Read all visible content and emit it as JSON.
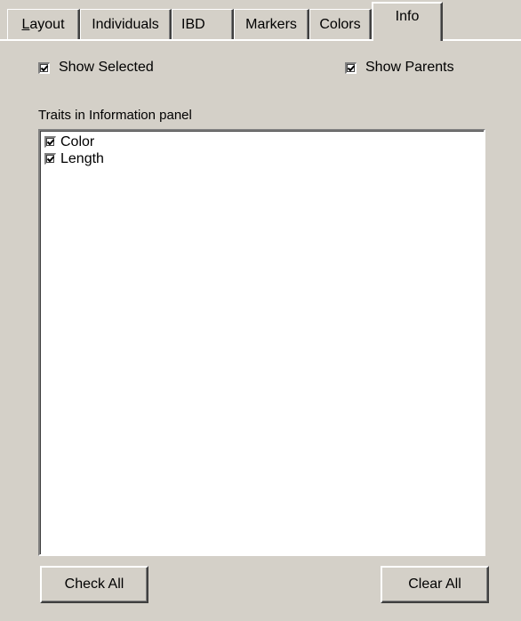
{
  "tabs": [
    {
      "label": "Layout",
      "mnemonic": "L",
      "rest": "ayout"
    },
    {
      "label": "Individuals"
    },
    {
      "label": "IBD"
    },
    {
      "label": "Markers"
    },
    {
      "label": "Colors"
    },
    {
      "label": "Info",
      "active": true
    }
  ],
  "options": {
    "show_selected": {
      "label": "Show Selected",
      "checked": true
    },
    "show_parents": {
      "label": "Show Parents",
      "checked": true
    }
  },
  "traits": {
    "label": "Traits in Information panel",
    "items": [
      {
        "label": "Color",
        "checked": true
      },
      {
        "label": "Length",
        "checked": true
      }
    ]
  },
  "buttons": {
    "check_all": "Check All",
    "clear_all": "Clear All"
  }
}
